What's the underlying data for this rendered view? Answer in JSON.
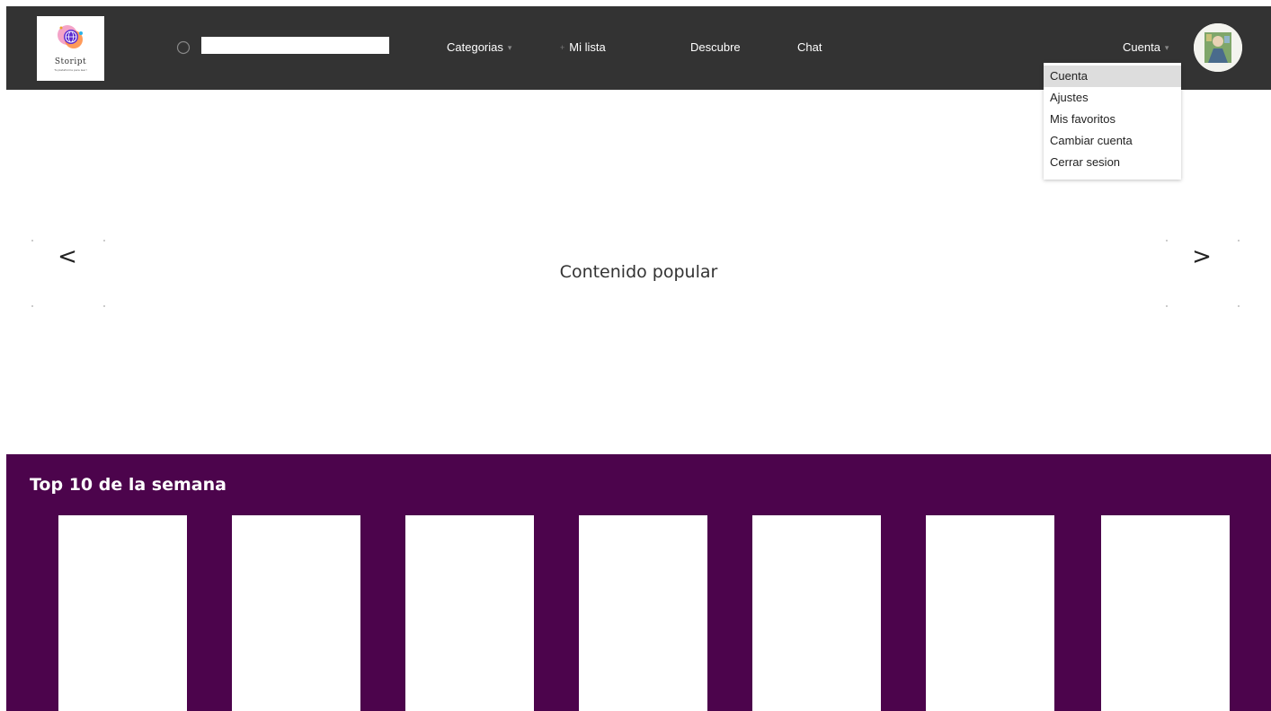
{
  "logo": {
    "word": "Stoript",
    "tagline": "Tu plataforma para leer!"
  },
  "search": {
    "placeholder": "",
    "value": ""
  },
  "nav": {
    "categories": "Categorias",
    "my_list": "Mi lista",
    "discover": "Descubre",
    "chat": "Chat",
    "account": "Cuenta"
  },
  "account_menu": {
    "items": [
      {
        "label": "Cuenta",
        "active": true
      },
      {
        "label": "Ajustes",
        "active": false
      },
      {
        "label": "Mis favoritos",
        "active": false
      },
      {
        "label": "Cambiar cuenta",
        "active": false
      },
      {
        "label": "Cerrar sesion",
        "active": false
      }
    ]
  },
  "hero": {
    "title": "Contenido popular",
    "prev": "<",
    "next": ">"
  },
  "top10": {
    "title": "Top 10 de la semana",
    "cards": 7
  },
  "colors": {
    "navbar": "#333333",
    "top10_background": "#4c044c",
    "menu_highlight": "#dddddd"
  }
}
